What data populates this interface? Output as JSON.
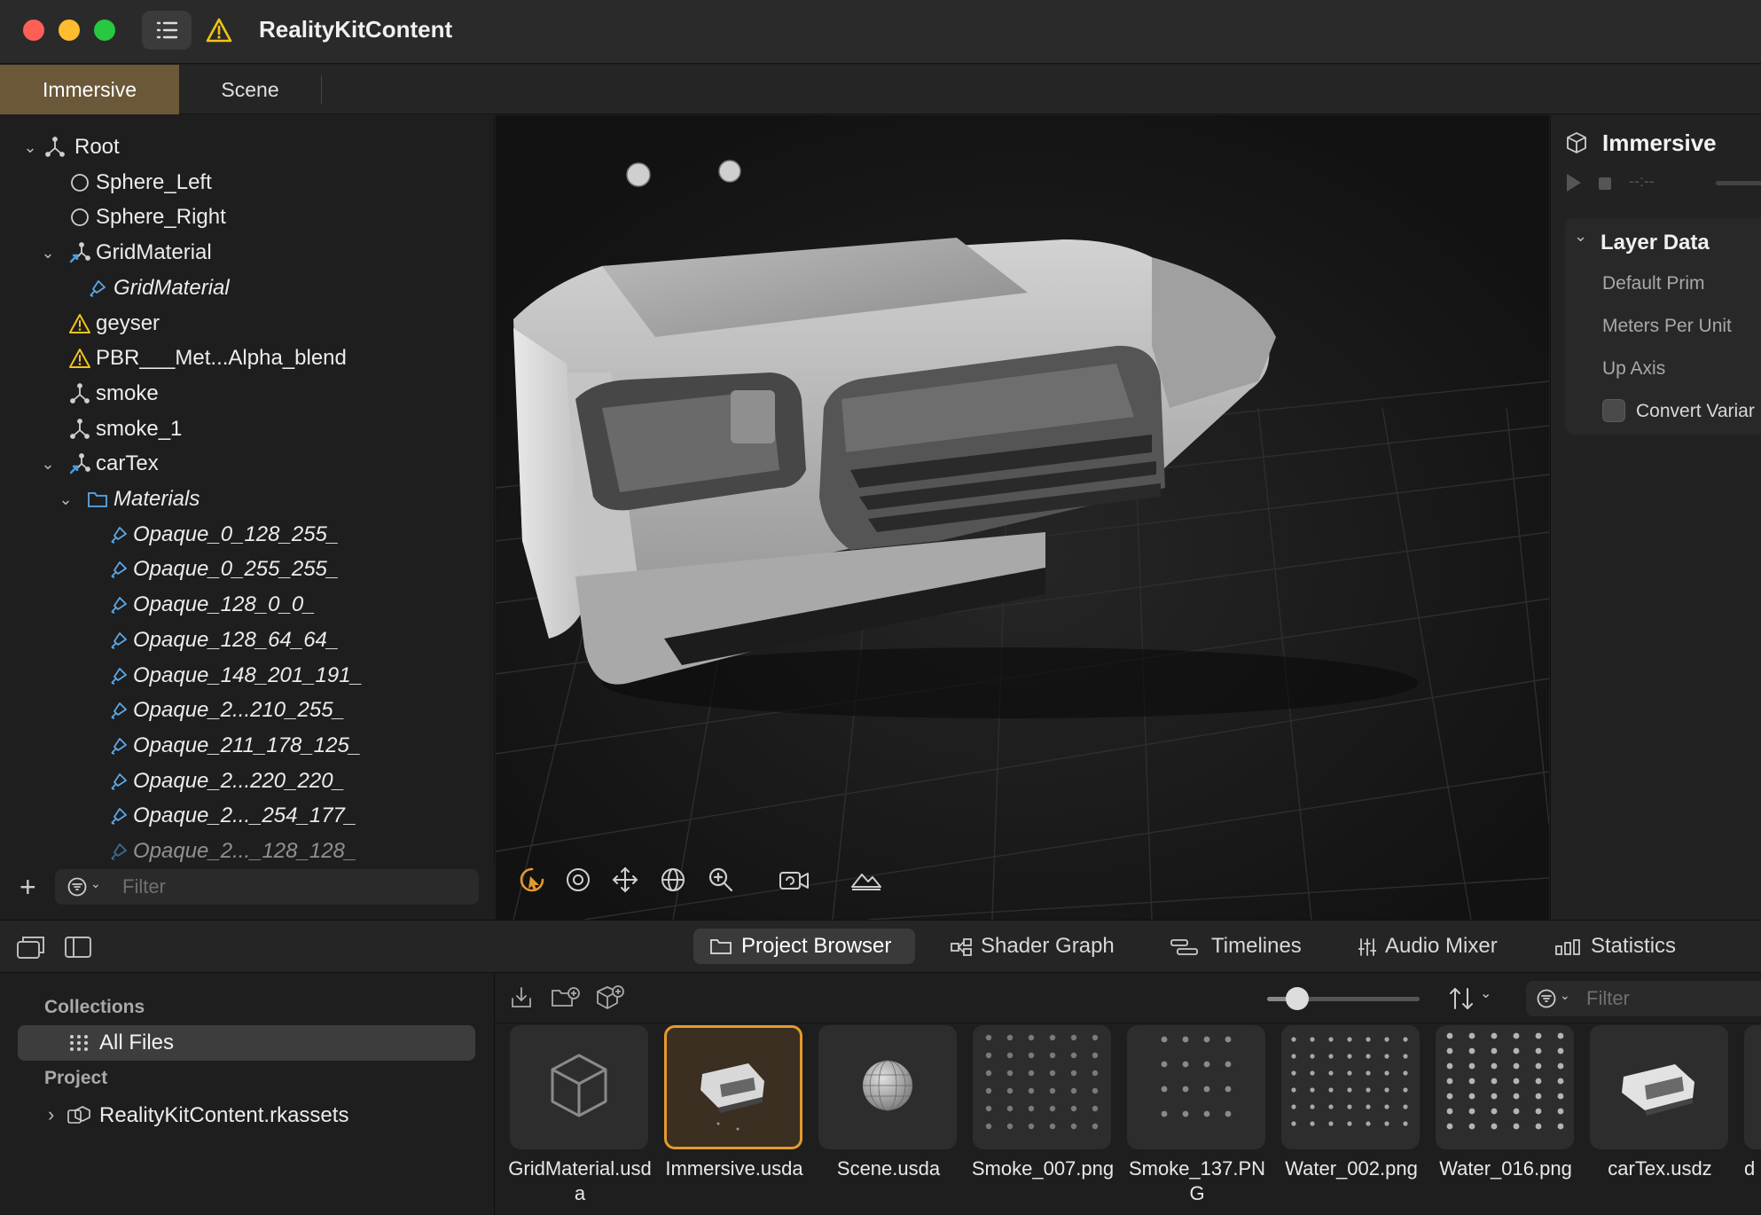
{
  "window": {
    "title": "RealityKitContent",
    "traffic_lights": [
      "#fe5f57",
      "#febc2e",
      "#28c840"
    ],
    "accent": "#e59a2d"
  },
  "tabs": [
    {
      "label": "Immersive",
      "active": true
    },
    {
      "label": "Scene",
      "active": false
    }
  ],
  "outliner": {
    "items": [
      {
        "label": "Root",
        "icon": "entity-icon",
        "expanded": true
      },
      {
        "label": "Sphere_Left",
        "icon": "sphere-icon"
      },
      {
        "label": "Sphere_Right",
        "icon": "sphere-icon"
      },
      {
        "label": "GridMaterial",
        "icon": "entity-reference-icon",
        "expanded": true
      },
      {
        "label": "GridMaterial",
        "icon": "material-icon"
      },
      {
        "label": "geyser",
        "icon": "warning-icon"
      },
      {
        "label": "PBR___Met...Alpha_blend",
        "icon": "warning-icon"
      },
      {
        "label": "smoke",
        "icon": "entity-icon"
      },
      {
        "label": "smoke_1",
        "icon": "entity-icon"
      },
      {
        "label": "carTex",
        "icon": "entity-reference-icon",
        "expanded": true
      },
      {
        "label": "Materials",
        "icon": "folder-icon",
        "expanded": true
      },
      {
        "label": "Opaque_0_128_255_",
        "icon": "material-icon"
      },
      {
        "label": "Opaque_0_255_255_",
        "icon": "material-icon"
      },
      {
        "label": "Opaque_128_0_0_",
        "icon": "material-icon"
      },
      {
        "label": "Opaque_128_64_64_",
        "icon": "material-icon"
      },
      {
        "label": "Opaque_148_201_191_",
        "icon": "material-icon"
      },
      {
        "label": "Opaque_2...210_255_",
        "icon": "material-icon"
      },
      {
        "label": "Opaque_211_178_125_",
        "icon": "material-icon"
      },
      {
        "label": "Opaque_2...220_220_",
        "icon": "material-icon"
      },
      {
        "label": "Opaque_2..._254_177_",
        "icon": "material-icon"
      },
      {
        "label": "Opaque_2..._128_128_",
        "icon": "material-icon"
      }
    ],
    "filter_placeholder": "Filter"
  },
  "inspector": {
    "title": "Immersive",
    "time": "--:--",
    "section": "Layer Data",
    "fields": [
      "Default Prim",
      "Meters Per Unit",
      "Up Axis"
    ],
    "checkbox_label": "Convert Variar"
  },
  "bottom_tabs": [
    {
      "label": "Project Browser",
      "icon": "folder-icon",
      "active": true
    },
    {
      "label": "Shader Graph",
      "icon": "shader-graph-icon"
    },
    {
      "label": "Timelines",
      "icon": "timelines-icon"
    },
    {
      "label": "Audio Mixer",
      "icon": "audio-mixer-icon"
    },
    {
      "label": "Statistics",
      "icon": "statistics-icon"
    }
  ],
  "collections": {
    "heading": "Collections",
    "all_files": "All Files",
    "project_heading": "Project",
    "project_item": "RealityKitContent.rkassets"
  },
  "browser": {
    "filter_placeholder": "Filter",
    "zoom_level": 0.2,
    "assets": [
      {
        "name": "GridMaterial.usda",
        "thumb": "cube-icon"
      },
      {
        "name": "Immersive.usda",
        "thumb": "car-thumbnail",
        "selected": true
      },
      {
        "name": "Scene.usda",
        "thumb": "sphere-thumbnail"
      },
      {
        "name": "Smoke_007.png",
        "thumb": "smoke-sprites-thumbnail"
      },
      {
        "name": "Smoke_137.PNG",
        "thumb": "smoke-sprites-thumbnail"
      },
      {
        "name": "Water_002.png",
        "thumb": "water-sprites-thumbnail"
      },
      {
        "name": "Water_016.png",
        "thumb": "water-sprites-thumbnail"
      },
      {
        "name": "carTex.usdz",
        "thumb": "car-thumbnail"
      },
      {
        "name": "d",
        "thumb": "partial"
      }
    ]
  }
}
